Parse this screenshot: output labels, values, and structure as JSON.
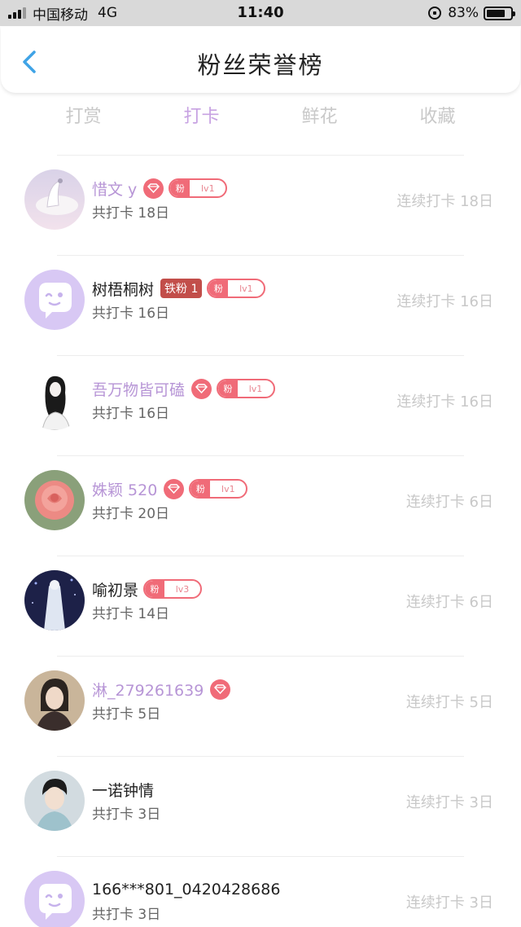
{
  "status_bar": {
    "carrier": "中国移动",
    "network": "4G",
    "time": "11:40",
    "battery": "83%"
  },
  "header": {
    "title": "粉丝荣誉榜"
  },
  "tabs": [
    {
      "label": "打赏",
      "active": false
    },
    {
      "label": "打卡",
      "active": true
    },
    {
      "label": "鲜花",
      "active": false
    },
    {
      "label": "收藏",
      "active": false
    }
  ],
  "rows": [
    {
      "name": "惜文 y",
      "name_color": "purple",
      "diamond": true,
      "iron": "",
      "fan": "粉",
      "level": "lv1",
      "total": "共打卡 18日",
      "streak": "连续打卡 18日",
      "avatar": "avatar-peacock"
    },
    {
      "name": "树梧桐树",
      "name_color": "dark",
      "diamond": false,
      "iron": "铁粉 1",
      "fan": "粉",
      "level": "lv1",
      "total": "共打卡 16日",
      "streak": "连续打卡 16日",
      "avatar": "avatar-default"
    },
    {
      "name": "吾万物皆可磕",
      "name_color": "purple",
      "diamond": true,
      "iron": "",
      "fan": "粉",
      "level": "lv1",
      "total": "共打卡 16日",
      "streak": "连续打卡 16日",
      "avatar": "avatar-sketch"
    },
    {
      "name": "姝颖 520",
      "name_color": "purple",
      "diamond": true,
      "iron": "",
      "fan": "粉",
      "level": "lv1",
      "total": "共打卡 20日",
      "streak": "连续打卡 6日",
      "avatar": "avatar-rose"
    },
    {
      "name": "喻初景",
      "name_color": "dark",
      "diamond": false,
      "iron": "",
      "fan": "粉",
      "level": "lv3",
      "total": "共打卡 14日",
      "streak": "连续打卡 6日",
      "avatar": "avatar-night"
    },
    {
      "name": "淋_279261639",
      "name_color": "purple",
      "diamond": true,
      "iron": "",
      "fan": "",
      "level": "",
      "total": "共打卡 5日",
      "streak": "连续打卡 5日",
      "avatar": "avatar-portrait"
    },
    {
      "name": "一诺钟情",
      "name_color": "dark",
      "diamond": false,
      "iron": "",
      "fan": "",
      "level": "",
      "total": "共打卡 3日",
      "streak": "连续打卡 3日",
      "avatar": "avatar-boy"
    },
    {
      "name": "166***801_0420428686",
      "name_color": "dark",
      "diamond": false,
      "iron": "",
      "fan": "",
      "level": "",
      "total": "共打卡 3日",
      "streak": "连续打卡 3日",
      "avatar": "avatar-default"
    }
  ],
  "colors": {
    "accent": "#c7a2e2",
    "badge_red": "#f06b78",
    "iron_red": "#c24e4a"
  }
}
